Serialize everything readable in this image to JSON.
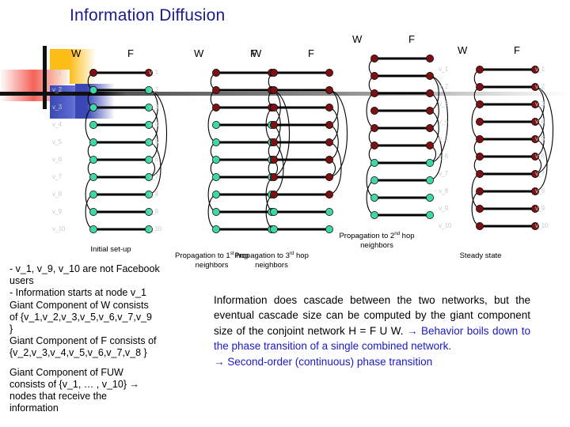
{
  "slide": {
    "title": "Information Diffusion",
    "title_color": "#1a1a8c"
  },
  "colors": {
    "infected_node": "#7b1113",
    "uninfected_node": "#3fd6a8",
    "edge": "#000000",
    "arc": "#000000",
    "node_label": "#c9c9c9",
    "accent_blue": "#1a18c8",
    "logo_yellow": "#fbbc16",
    "logo_red": "#f3564b",
    "logo_blue": "#3a48b5"
  },
  "node_labels": [
    "v_1",
    "v_2",
    "v_3",
    "v_4",
    "v_5",
    "v_6",
    "v_7",
    "v_8",
    "v_9",
    "v_10"
  ],
  "column_labels": {
    "w": "W",
    "f": "F"
  },
  "panels": [
    {
      "id": "panel-initial",
      "caption": "Initial set-up",
      "w_label": "W",
      "f_label": "F",
      "show_left_labels": true,
      "show_right_labels": true,
      "infected": [
        1
      ],
      "states": [
        "infected",
        "clean",
        "clean",
        "clean",
        "clean",
        "clean",
        "clean",
        "clean",
        "clean",
        "clean"
      ]
    },
    {
      "id": "panel-hop1",
      "caption": "Propagation to 1st hop neighbors",
      "caption_sup": "st",
      "w_label": "W",
      "f_label": "F",
      "show_left_labels": false,
      "show_right_labels": false,
      "infected": [
        1,
        2,
        3
      ],
      "states": [
        "infected",
        "infected",
        "infected",
        "clean",
        "clean",
        "clean",
        "clean",
        "clean",
        "clean",
        "clean"
      ]
    },
    {
      "id": "panel-hop3",
      "caption": "Propagation to 3rd hop neighbors",
      "caption_sup": "rd",
      "w_label": "W",
      "f_label": "F",
      "show_left_labels": false,
      "show_right_labels": false,
      "infected": [
        1,
        2,
        3,
        4,
        5,
        6,
        7,
        8
      ],
      "states": [
        "infected",
        "infected",
        "infected",
        "infected",
        "infected",
        "infected",
        "infected",
        "infected",
        "clean",
        "clean"
      ]
    },
    {
      "id": "panel-hop2",
      "caption": "Propagation to 2nd hop neighbors",
      "caption_sup": "nd",
      "w_label": "W",
      "f_label": "F",
      "show_left_labels": false,
      "show_right_labels": false,
      "infected": [
        1,
        2,
        3,
        4,
        5,
        6
      ],
      "states": [
        "infected",
        "infected",
        "infected",
        "infected",
        "infected",
        "infected",
        "clean",
        "clean",
        "clean",
        "clean"
      ]
    },
    {
      "id": "panel-steady",
      "caption": "Steady state",
      "w_label": "W",
      "f_label": "F",
      "show_left_labels": true,
      "show_right_labels": true,
      "infected": [
        1,
        2,
        3,
        4,
        5,
        6,
        7,
        8,
        9,
        10
      ],
      "states": [
        "infected",
        "infected",
        "infected",
        "infected",
        "infected",
        "infected",
        "infected",
        "infected",
        "infected",
        "infected"
      ]
    }
  ],
  "notes_left": [
    "- v_1, v_9, v_10 are not Facebook",
    "users",
    "- Information starts at node v_1",
    " Giant Component of W consists",
    " of {v_1,v_2,v_3,v_5,v_6,v_7,v_9",
    " }",
    "Giant Component of F consists of",
    " {v_2,v_3,v_4,v_5,v_6,v_7,v_8 }"
  ],
  "notes_left_2": [
    "Giant Component of FUW",
    "consists of {v_1, … , v_10} →",
    "nodes that receive the",
    "information"
  ],
  "conclusion": {
    "part_black": "Information does cascade between the two networks, but the eventual cascade size can be computed by the giant component size of the conjoint network H = F U W. ",
    "part_blue": "→ Behavior boils down to the phase transition of a single combined network.",
    "part_blue2": "→ Second-order (continuous) phase transition"
  }
}
